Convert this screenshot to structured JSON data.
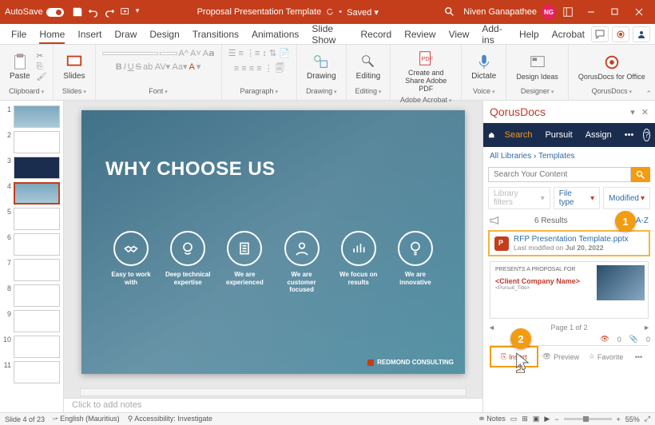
{
  "title_bar": {
    "autosave": "AutoSave",
    "doc_title": "Proposal Presentation Template",
    "saved_status": "Saved ▾",
    "user": "Niven Ganapathee",
    "initials": "NG"
  },
  "menu": [
    "File",
    "Home",
    "Insert",
    "Draw",
    "Design",
    "Transitions",
    "Animations",
    "Slide Show",
    "Record",
    "Review",
    "View",
    "Add-ins",
    "Help",
    "Acrobat"
  ],
  "ribbon": {
    "clipboard": {
      "paste": "Paste",
      "label": "Clipboard"
    },
    "slides": {
      "btn": "Slides",
      "label": "Slides"
    },
    "font": {
      "label": "Font"
    },
    "paragraph": {
      "label": "Paragraph"
    },
    "drawing": {
      "btn": "Drawing",
      "label": "Drawing"
    },
    "editing": {
      "btn": "Editing",
      "label": "Editing"
    },
    "adobe": {
      "btn": "Create and Share Adobe PDF",
      "label": "Adobe Acrobat"
    },
    "dictate": {
      "btn": "Dictate",
      "label": "Voice"
    },
    "designer": {
      "btn": "Design Ideas",
      "label": "Designer"
    },
    "qorus": {
      "btn": "QorusDocs for Office",
      "label": "QorusDocs"
    }
  },
  "slide": {
    "title": "WHY CHOOSE US",
    "features": [
      "Easy to work with",
      "Deep technical expertise",
      "We are experienced",
      "We are customer focused",
      "We focus on results",
      "We are innovative"
    ],
    "logo": "REDMOND CONSULTING"
  },
  "notes_placeholder": "Click to add notes",
  "pane": {
    "title": "QorusDocs",
    "tabs": [
      "Search",
      "Pursuit",
      "Assign"
    ],
    "crumb1": "All Libraries",
    "crumb2": "Templates",
    "search_ph": "Search Your Content",
    "filter1": "Library filters",
    "filter2": "File type",
    "filter3": "Modified",
    "results_count": "6 Results",
    "sort": "A-Z",
    "result_title": "RFP Presentation Template.pptx",
    "result_sub_pre": "Last modified on ",
    "result_sub_date": "Jul 20, 2022",
    "preview_head": "PRESENTS A PROPOSAL FOR",
    "preview_client": "<Client Company Name>",
    "preview_sub": "<Pursuit_Title>",
    "page": "Page 1 of 2",
    "count0": "0",
    "count1": "0",
    "actions": [
      "Insert",
      "Preview",
      "Favorite"
    ]
  },
  "status": {
    "slide": "Slide 4 of 23",
    "lang": "English (Mauritius)",
    "access": "Accessibility: Investigate",
    "notes": "Notes",
    "zoom": "55%"
  }
}
